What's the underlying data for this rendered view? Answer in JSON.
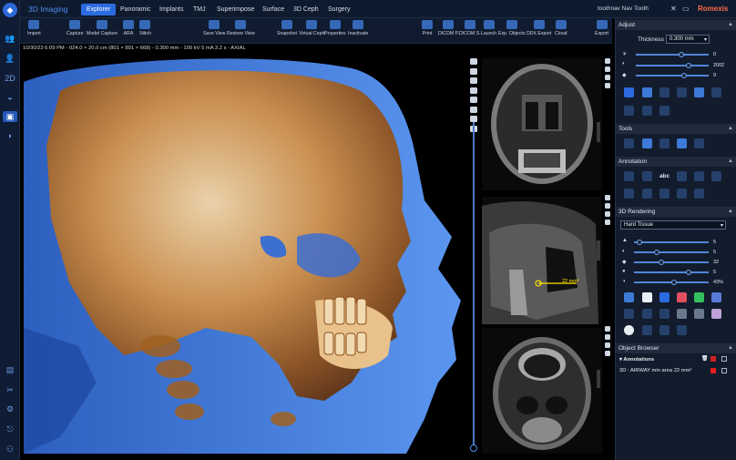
{
  "app": {
    "title": "3D Imaging",
    "brand": "Romexis",
    "case_name": "toothnav Nav Tooth"
  },
  "nav_tabs": [
    "Explorer",
    "Panoramic",
    "Implants",
    "TMJ",
    "Superimpose",
    "Surface",
    "3D Ceph",
    "Surgery"
  ],
  "toolbar": [
    {
      "label": "Import"
    },
    {
      "label": "Capture"
    },
    {
      "label": "Model Capture"
    },
    {
      "label": "ARA"
    },
    {
      "label": "Stitch"
    },
    {
      "label": "Save View"
    },
    {
      "label": "Restore View"
    },
    {
      "label": "Snapshot"
    },
    {
      "label": "Virtual Ceph"
    },
    {
      "label": "Properties"
    },
    {
      "label": "Inactivate"
    },
    {
      "label": "Print"
    },
    {
      "label": "DICOM P."
    },
    {
      "label": "DICOM S."
    },
    {
      "label": "Launch"
    },
    {
      "label": "Exp. Objects"
    },
    {
      "label": "DDX Export"
    },
    {
      "label": "Cloud"
    },
    {
      "label": "Export"
    }
  ],
  "status_line": "10/30/23 6:09 PM - 024.0 × 20.0 cm (801 × 801 × 668) - 0.300 mm - 100 kV 5 mA 3.2 s - AXIAL",
  "measurement": "22 mm²",
  "adjust": {
    "title": "Adjust",
    "thickness_label": "Thickness",
    "thickness_value": "0.300 mm",
    "sliders": [
      {
        "value": "0",
        "level": 0.62
      },
      {
        "value": "2002",
        "level": 0.73
      },
      {
        "value": "9",
        "level": 0.66
      }
    ]
  },
  "tools": {
    "title": "Tools"
  },
  "annotation": {
    "title": "Annotation",
    "abc": "abc"
  },
  "rendering": {
    "title": "3D Rendering",
    "preset": "Hard Tissue",
    "sliders": [
      {
        "value": "5",
        "level": 0.07
      },
      {
        "value": "5",
        "level": 0.3
      },
      {
        "value": "32",
        "level": 0.36
      },
      {
        "value": "5",
        "level": 0.73
      },
      {
        "value": "43%",
        "level": 0.54
      }
    ]
  },
  "object_browser": {
    "title": "Object Browser",
    "group": "Annotations",
    "item": "3D : AIRWAY min area 22 mm²"
  },
  "colors": {
    "accent": "#2b6ae0",
    "brand": "#ff6b4a",
    "bone": "#c8853c",
    "skin": "#4a88e8"
  }
}
